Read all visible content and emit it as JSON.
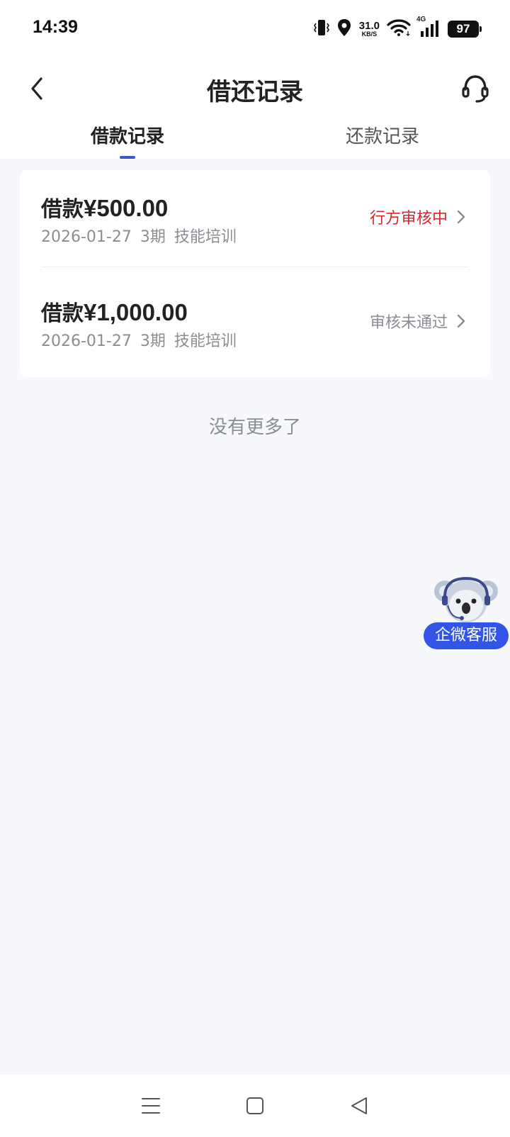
{
  "status_bar": {
    "time": "14:39",
    "net_speed_value": "31.0",
    "net_speed_unit": "KB/S",
    "network_type": "4G",
    "battery": "97"
  },
  "header": {
    "title": "借还记录"
  },
  "tabs": [
    {
      "label": "借款记录",
      "active": true
    },
    {
      "label": "还款记录",
      "active": false
    }
  ],
  "records": [
    {
      "amount_label": "借款",
      "amount": "¥500.00",
      "date": "2026-01-27",
      "periods": "3期",
      "purpose": "技能培训",
      "status": "行方审核中",
      "status_color": "#d8262c"
    },
    {
      "amount_label": "借款",
      "amount": "¥1,000.00",
      "date": "2026-01-27",
      "periods": "3期",
      "purpose": "技能培训",
      "status": "审核未通过",
      "status_color": "#8a8d94"
    }
  ],
  "list_footer": "没有更多了",
  "float_service": {
    "label": "企微客服",
    "color": "#3255e8"
  },
  "colors": {
    "accent": "#3d52d5",
    "background": "#f7f8fc"
  }
}
